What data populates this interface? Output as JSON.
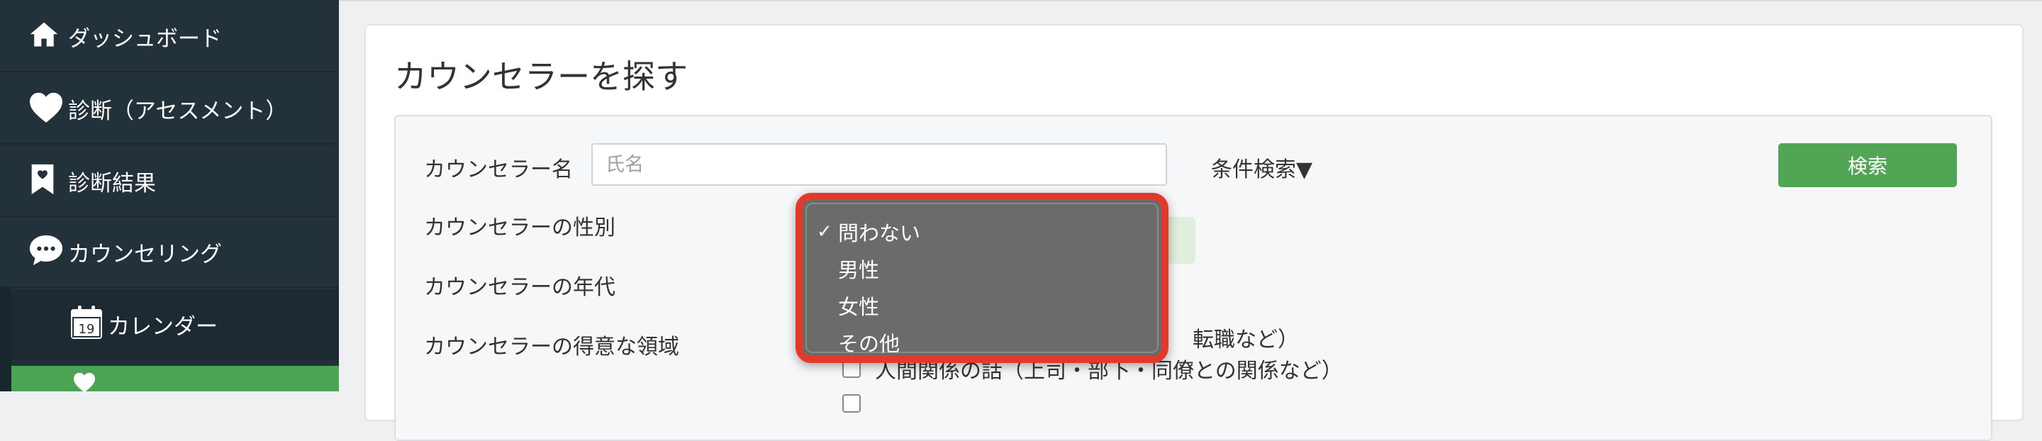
{
  "sidebar": {
    "items": [
      {
        "label": "ダッシュボード",
        "icon": "home-icon"
      },
      {
        "label": "診断（アセスメント）",
        "icon": "heart-icon"
      },
      {
        "label": "診断結果",
        "icon": "bookmark-icon"
      },
      {
        "label": "カウンセリング",
        "icon": "chat-bubble-icon"
      },
      {
        "label": "カレンダー",
        "icon": "calendar-icon",
        "icon_text": "19"
      }
    ],
    "active_color": "#4aa454",
    "background": "#22313a"
  },
  "main": {
    "title": "カウンセラーを探す",
    "form": {
      "name_label": "カウンセラー名",
      "name_placeholder": "氏名",
      "name_value": "",
      "advanced_toggle": "条件検索▼",
      "search_button": "検索",
      "gender_label": "カウンセラーの性別",
      "age_label": "カウンセラーの年代",
      "specialty_label": "カウンセラーの得意な領域",
      "specialty_options": [
        "転職など）",
        "人間関係の話（上司・部下・同僚との関係など）"
      ]
    }
  },
  "dropdown": {
    "selected_mark": "✓",
    "options": [
      "問わない",
      "男性",
      "女性",
      "その他"
    ],
    "selected_index": 0,
    "highlight_color": "#e3392a"
  },
  "colors": {
    "accent_green": "#52a555",
    "sidebar_bg": "#22313a"
  }
}
